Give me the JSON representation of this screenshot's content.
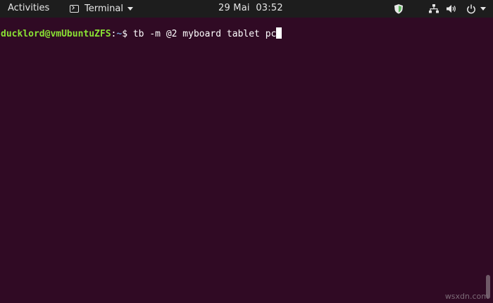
{
  "topbar": {
    "activities_label": "Activities",
    "app_menu_label": "Terminal",
    "clock": "29 Mai  03:52"
  },
  "terminal": {
    "user_host": "ducklord@vmUbuntuZFS",
    "colon": ":",
    "cwd": "~",
    "prompt_symbol": "$ ",
    "command": "tb -m @2 myboard tablet pc"
  },
  "watermark": "wsxdn.com",
  "colors": {
    "topbar_bg": "#1d1d1d",
    "terminal_bg": "#300a24",
    "prompt_user": "#8ae234",
    "prompt_path": "#729fcf",
    "text": "#ffffff"
  }
}
